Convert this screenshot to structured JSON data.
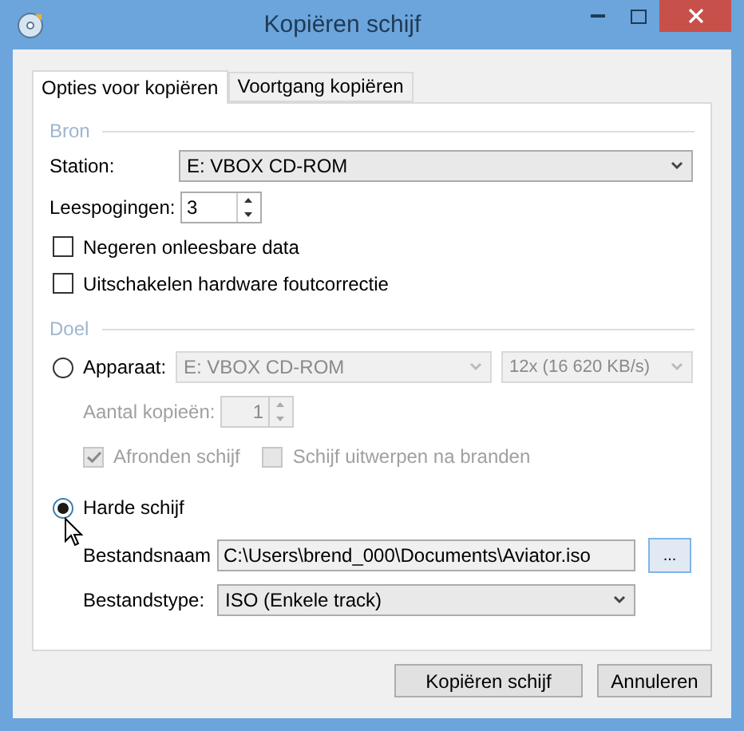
{
  "window": {
    "title": "Kopiëren schijf"
  },
  "tabs": [
    {
      "label": "Opties voor kopiëren",
      "selected": true
    },
    {
      "label": "Voortgang kopiëren",
      "selected": false
    }
  ],
  "source": {
    "legend": "Bron",
    "station": {
      "label": "Station:",
      "value": "E: VBOX CD-ROM"
    },
    "read_attempts": {
      "label": "Leespogingen:",
      "value": "3"
    },
    "options": [
      {
        "label": "Negeren onleesbare data",
        "checked": false
      },
      {
        "label": "Uitschakelen hardware foutcorrectie",
        "checked": false
      }
    ]
  },
  "target": {
    "legend": "Doel",
    "device": {
      "label": "Apparaat:",
      "selected": false,
      "disabled": true,
      "value": "E: VBOX CD-ROM",
      "speed": "12x (16 620 KB/s)"
    },
    "copies": {
      "label": "Aantal kopieën:",
      "value": "1"
    },
    "options": [
      {
        "label": "Afronden schijf",
        "checked": true
      },
      {
        "label": "Schijf uitwerpen na branden",
        "checked": false
      }
    ],
    "hard_disk": {
      "label": "Harde schijf",
      "selected": true,
      "filename": {
        "label": "Bestandsnaam",
        "value": "C:\\Users\\brend_000\\Documents\\Aviator.iso"
      },
      "browse": "...",
      "filetype": {
        "label": "Bestandstype:",
        "value": "ISO (Enkele track)"
      }
    }
  },
  "buttons": [
    "Kopiëren schijf",
    "Annuleren"
  ]
}
